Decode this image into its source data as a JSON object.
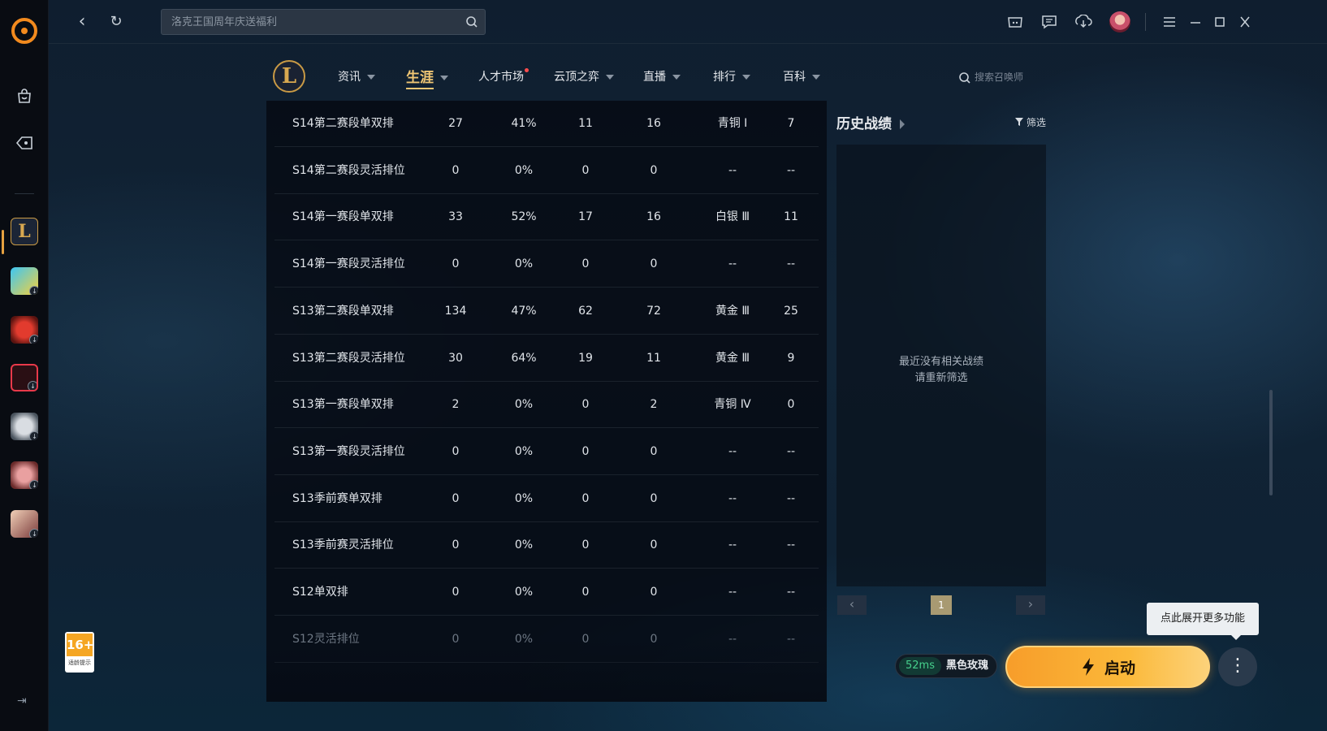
{
  "search": {
    "placeholder": "洛克王国周年庆送福利"
  },
  "age_rating": {
    "value": "16+",
    "caption": "适龄提示"
  },
  "sidebar": {
    "games": [
      {
        "name": "league-of-legends",
        "active": true
      },
      {
        "name": "qq-speed",
        "download": true
      },
      {
        "name": "crossfire",
        "download": true
      },
      {
        "name": "valorant",
        "download": true
      },
      {
        "name": "crossfire-hd",
        "download": true
      },
      {
        "name": "dnf",
        "download": true
      },
      {
        "name": "naraka",
        "download": true
      }
    ]
  },
  "nav": {
    "items": [
      {
        "label": "资讯",
        "caret": true
      },
      {
        "label": "生涯",
        "caret": true,
        "active": true
      },
      {
        "label": "人才市场",
        "dot": true
      },
      {
        "label": "云顶之弈",
        "caret": true
      },
      {
        "label": "直播",
        "caret": true
      },
      {
        "label": "排行",
        "caret": true
      },
      {
        "label": "百科",
        "caret": true
      }
    ],
    "summoner_search": "搜索召唤师"
  },
  "table": {
    "rows": [
      [
        "S14第二赛段单双排",
        "27",
        "41%",
        "11",
        "16",
        "青铜 Ⅰ",
        "7"
      ],
      [
        "S14第二赛段灵活排位",
        "0",
        "0%",
        "0",
        "0",
        "--",
        "--"
      ],
      [
        "S14第一赛段单双排",
        "33",
        "52%",
        "17",
        "16",
        "白银 Ⅲ",
        "11"
      ],
      [
        "S14第一赛段灵活排位",
        "0",
        "0%",
        "0",
        "0",
        "--",
        "--"
      ],
      [
        "S13第二赛段单双排",
        "134",
        "47%",
        "62",
        "72",
        "黄金 Ⅲ",
        "25"
      ],
      [
        "S13第二赛段灵活排位",
        "30",
        "64%",
        "19",
        "11",
        "黄金 Ⅲ",
        "9"
      ],
      [
        "S13第一赛段单双排",
        "2",
        "0%",
        "0",
        "2",
        "青铜 Ⅳ",
        "0"
      ],
      [
        "S13第一赛段灵活排位",
        "0",
        "0%",
        "0",
        "0",
        "--",
        "--"
      ],
      [
        "S13季前赛单双排",
        "0",
        "0%",
        "0",
        "0",
        "--",
        "--"
      ],
      [
        "S13季前赛灵活排位",
        "0",
        "0%",
        "0",
        "0",
        "--",
        "--"
      ],
      [
        "S12单双排",
        "0",
        "0%",
        "0",
        "0",
        "--",
        "--"
      ],
      [
        "S12灵活排位",
        "0",
        "0%",
        "0",
        "0",
        "--",
        "--"
      ]
    ]
  },
  "history": {
    "title": "历史战绩",
    "filter_label": "筛选",
    "empty_line1": "最近没有相关战绩",
    "empty_line2": "请重新筛选",
    "page": "1"
  },
  "status": {
    "ping": "52ms",
    "server": "黑色玫瑰"
  },
  "launch_label": "启动",
  "tooltip": "点此展开更多功能",
  "colors": {
    "accent": "#f0c674",
    "launch": "#f79d2a",
    "ping": "#46d08c"
  }
}
